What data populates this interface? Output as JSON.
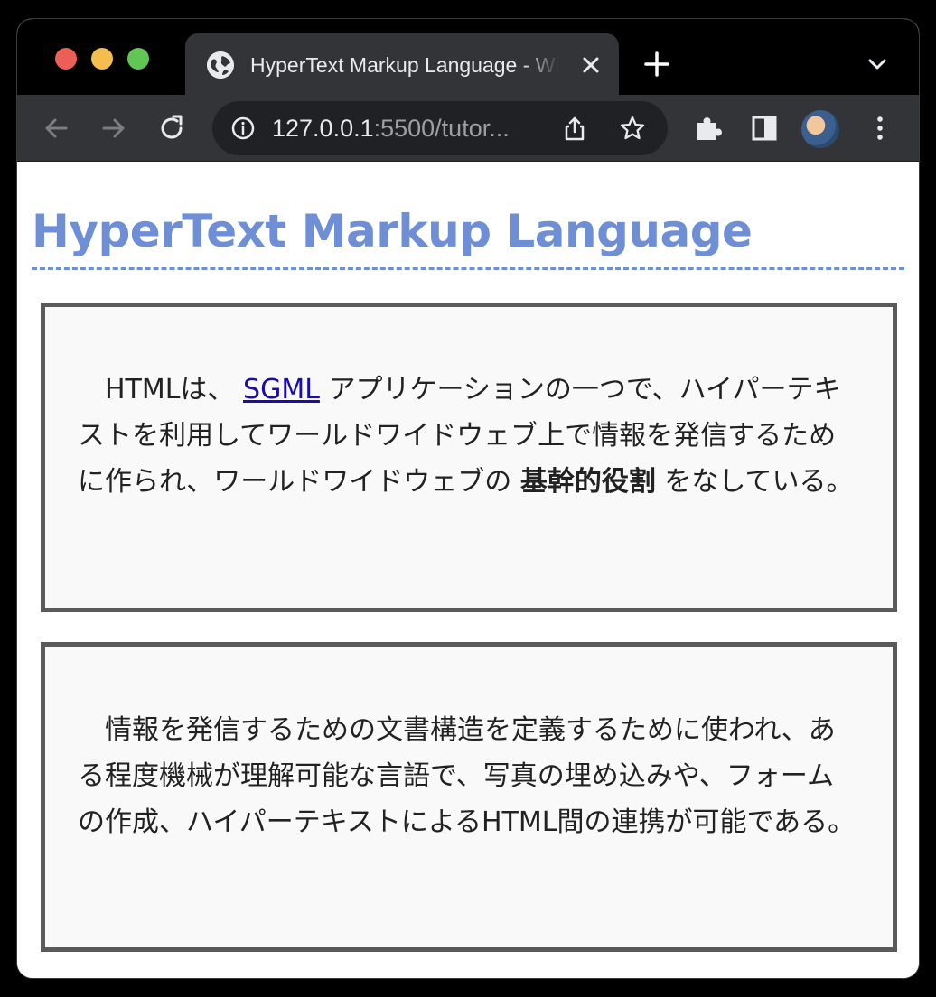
{
  "browser": {
    "tab_title": "HyperText Markup Language - Wikipedia",
    "url_host": "127.0.0.1",
    "url_rest": ":5500/tutor...",
    "colors": {
      "close": "#ec5f57",
      "minimize": "#f4be4f",
      "maximize": "#62c655"
    }
  },
  "page": {
    "title": "HyperText Markup Language",
    "paragraph1": {
      "before_link": "HTMLは、 ",
      "link": "SGML",
      "after_link": " アプリケーションの一つで、ハイパーテキストを利用してワールドワイドウェブ上で情報を発信するために作られ、ワールドワイドウェブの ",
      "bold": "基幹的役割",
      "after_bold": " をなしている。"
    },
    "paragraph2": "情報を発信するための文書構造を定義するために使われ、ある程度機械が理解可能な言語で、写真の埋め込みや、フォームの作成、ハイパーテキストによるHTML間の連携が可能である。",
    "colors": {
      "title": "#6e8fd6",
      "link": "#1a0dab",
      "box_border": "#5a5a5a"
    }
  }
}
